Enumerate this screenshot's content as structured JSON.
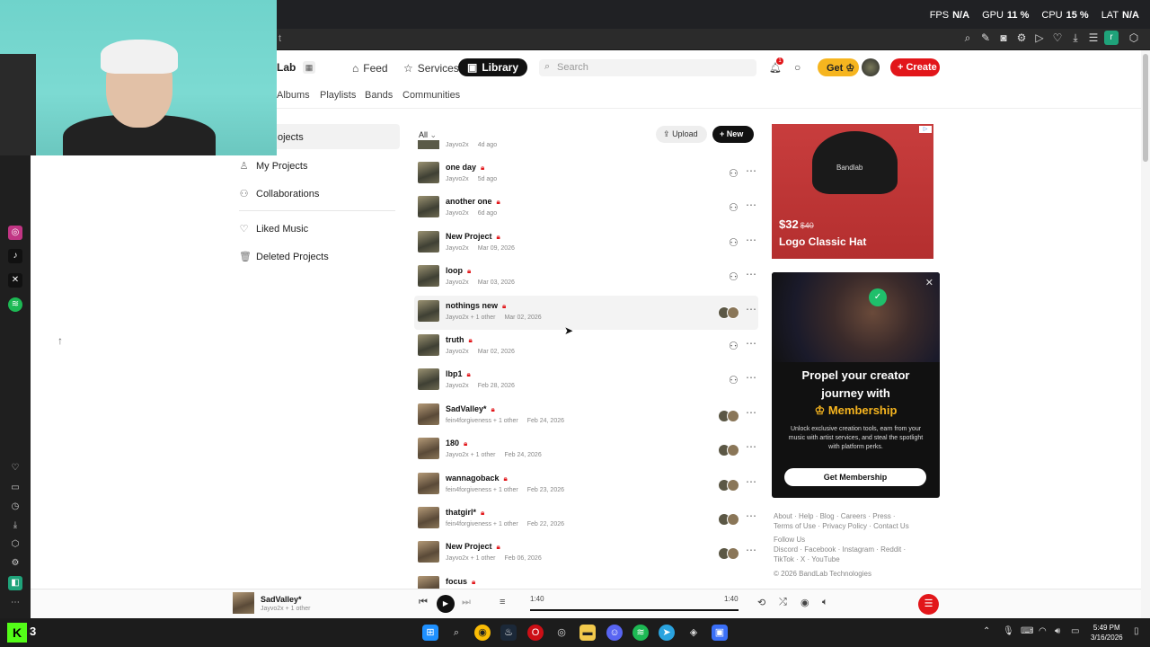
{
  "overlay": {
    "fps_label": "FPS",
    "fps": "N/A",
    "gpu_label": "GPU",
    "gpu": "11 %",
    "cpu_label": "CPU",
    "cpu": "15 %",
    "lat_label": "LAT",
    "lat": "N/A"
  },
  "browser": {
    "address_fragment": "t",
    "profile_initial": "r"
  },
  "site": {
    "logo": "Lab",
    "nav": [
      {
        "label": "Feed",
        "icon": "home-icon"
      },
      {
        "label": "Services",
        "icon": "star-icon"
      },
      {
        "label": "Library",
        "icon": "library-icon"
      }
    ],
    "search_placeholder": "Search",
    "notif_count": "1",
    "get_label": "Get",
    "create_label": "Create"
  },
  "subtabs": [
    "Albums",
    "Playlists",
    "Bands",
    "Communities"
  ],
  "sidebar": {
    "active": "ojects",
    "items": [
      {
        "label": "My Projects",
        "icon": "user-icon"
      },
      {
        "label": "Collaborations",
        "icon": "users-icon"
      },
      {
        "label": "Liked Music",
        "icon": "heart-icon"
      },
      {
        "label": "Deleted Projects",
        "icon": "trash-icon"
      }
    ]
  },
  "list": {
    "filter": "All",
    "upload_label": "Upload",
    "new_label": "New",
    "partial_top": {
      "artist": "Jayvo2x",
      "date": "4d ago"
    },
    "projects": [
      {
        "title": "one day",
        "artist": "Jayvo2x",
        "date": "5d ago",
        "collab": false
      },
      {
        "title": "another one",
        "artist": "Jayvo2x",
        "date": "6d ago",
        "collab": false
      },
      {
        "title": "New Project",
        "artist": "Jayvo2x",
        "date": "Mar 09, 2026",
        "collab": false
      },
      {
        "title": "loop",
        "artist": "Jayvo2x",
        "date": "Mar 03, 2026",
        "collab": false
      },
      {
        "title": "nothings new",
        "artist": "Jayvo2x + 1 other",
        "date": "Mar 02, 2026",
        "collab": true
      },
      {
        "title": "truth",
        "artist": "Jayvo2x",
        "date": "Mar 02, 2026",
        "collab": false
      },
      {
        "title": "lbp1",
        "artist": "Jayvo2x",
        "date": "Feb 28, 2026",
        "collab": false
      },
      {
        "title": "SadValley*",
        "artist": "fein4forgiveness + 1 other",
        "date": "Feb 24, 2026",
        "collab": true
      },
      {
        "title": "180",
        "artist": "Jayvo2x + 1 other",
        "date": "Feb 24, 2026",
        "collab": true
      },
      {
        "title": "wannagoback",
        "artist": "fein4forgiveness + 1 other",
        "date": "Feb 23, 2026",
        "collab": true
      },
      {
        "title": "thatgirl*",
        "artist": "fein4forgiveness + 1 other",
        "date": "Feb 22, 2026",
        "collab": true
      },
      {
        "title": "New Project",
        "artist": "Jayvo2x + 1 other",
        "date": "Feb 06, 2026",
        "collab": true
      },
      {
        "title": "focus",
        "artist": "",
        "date": "",
        "collab": true
      }
    ]
  },
  "ad1": {
    "brand": "Bandlab",
    "price": "$32",
    "old_price": "$40",
    "name": "Logo Classic Hat"
  },
  "ad2": {
    "line1": "Propel your creator",
    "line2": "journey with",
    "line3": "Membership",
    "desc": "Unlock exclusive creation tools, earn from your music with artist services, and steal the spotlight with platform perks.",
    "button": "Get Membership"
  },
  "footer": {
    "row1": "About · Help · Blog · Careers · Press ·",
    "row2": "Terms of Use · Privacy Policy · Contact Us",
    "row3": "Follow Us",
    "row4": "Discord · Facebook · Instagram · Reddit ·",
    "row5": "TikTok · X · YouTube",
    "row6": "© 2026 BandLab Technologies"
  },
  "player": {
    "title": "SadValley*",
    "meta": "Jayvo2x + 1 other",
    "elapsed": "1:40",
    "duration": "1:40",
    "progress": 1.0
  },
  "taskbar": {
    "kick_count": "3",
    "time": "5:49 PM",
    "date": "3/16/2026"
  }
}
